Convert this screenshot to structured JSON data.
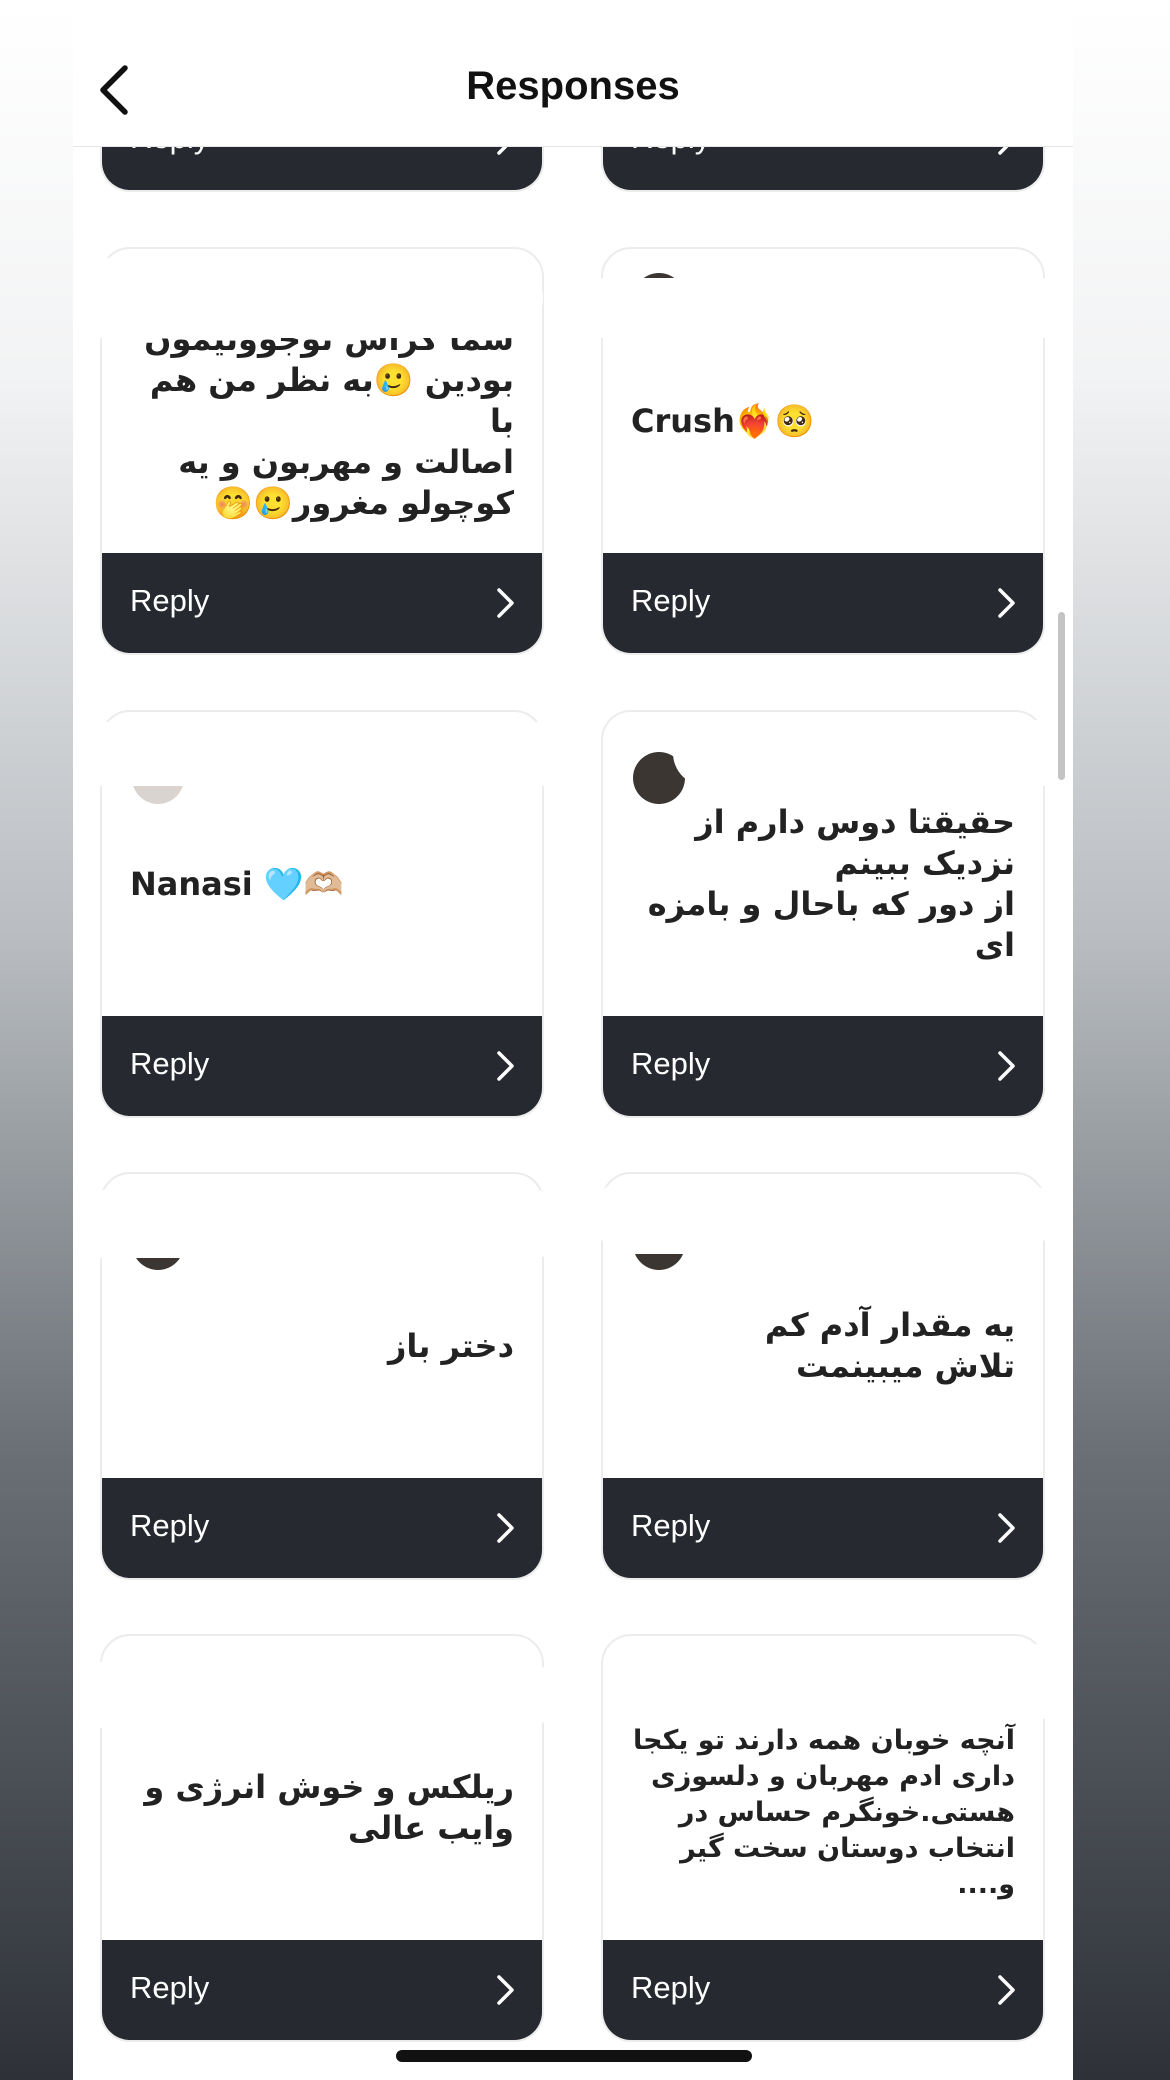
{
  "header": {
    "title": "Responses",
    "back_icon": "chevron-left-icon"
  },
  "colors": {
    "reply_bar": "#262a30",
    "card_bg": "#ffffff",
    "text": "#222222"
  },
  "reply_label": "Reply",
  "cards": [
    {
      "id": "card-top-left",
      "message": "",
      "reply": "Reply"
    },
    {
      "id": "card-top-right",
      "message": "",
      "reply": "Reply"
    },
    {
      "id": "card-1",
      "message": "شما کراش نوجوونیمون\nبودین 🥲به نظر من هم با\nاصالت و مهربون و یه\nکوچولو مغرور🥲🤭",
      "reply": "Reply"
    },
    {
      "id": "card-2",
      "message": "Crush❤️‍🔥🥺",
      "reply": "Reply"
    },
    {
      "id": "card-3",
      "message": "Nanasi 🩵🫶🏼",
      "reply": "Reply"
    },
    {
      "id": "card-4",
      "message": "حقیقتا دوس دارم از\nنزدیک ببینم\nاز دور که باحال و بامزه ای",
      "reply": "Reply"
    },
    {
      "id": "card-5",
      "message": "دختر باز",
      "reply": "Reply"
    },
    {
      "id": "card-6",
      "message": "یه مقدار آدم کم\nتلاش میبینمت",
      "reply": "Reply"
    },
    {
      "id": "card-7",
      "message": "ریلکس و خوش انرژی و\nوایب عالی",
      "reply": "Reply"
    },
    {
      "id": "card-8",
      "message": "آنچه خوبان همه دارند تو یکجا\nداری ادم مهربان و دلسوزی\nهستی.خونگرم حساس در\nانتخاب دوستان سخت گیر و....",
      "reply": "Reply"
    }
  ]
}
